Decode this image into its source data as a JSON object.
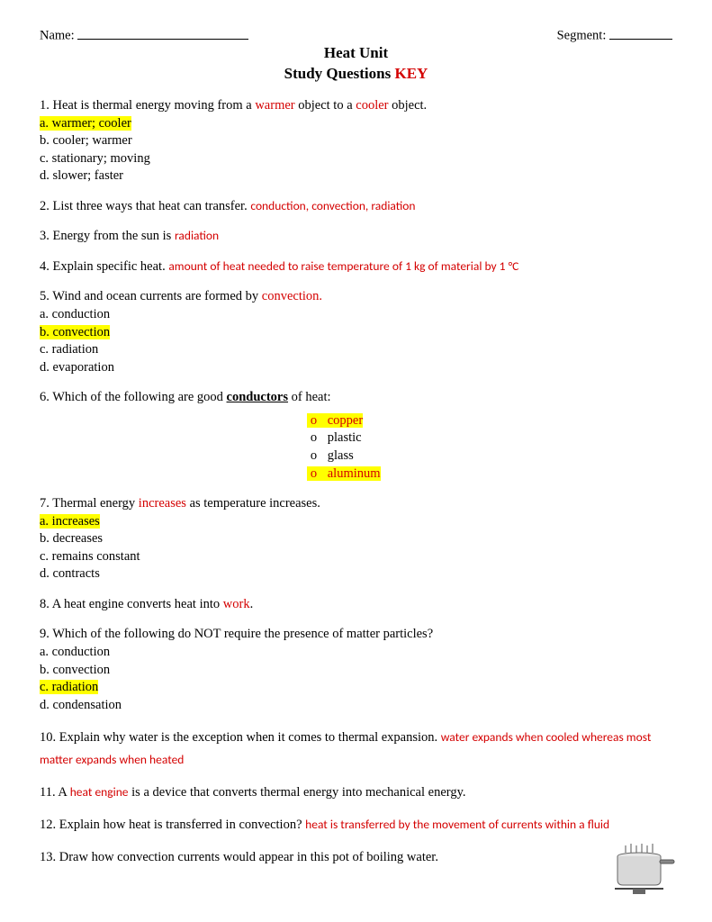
{
  "header": {
    "name_label": "Name:",
    "segment_label": "Segment:"
  },
  "title": {
    "line1": "Heat Unit",
    "line2_a": "Study Questions ",
    "line2_b": "KEY"
  },
  "q1": {
    "text_a": "1. Heat is thermal energy moving from a ",
    "blank1": "warmer",
    "text_b": " object to a ",
    "blank2": "cooler",
    "text_c": " object.",
    "a": "a. warmer; cooler",
    "b": "b. cooler; warmer",
    "c": "c. stationary; moving",
    "d": "d. slower; faster"
  },
  "q2": {
    "text": "2. List three ways that heat can transfer.  ",
    "ans": "conduction, convection, radiation"
  },
  "q3": {
    "text": "3. Energy from the sun is ",
    "ans": "radiation"
  },
  "q4": {
    "text": "4. Explain specific heat.  ",
    "ans": "amount of heat needed to raise temperature of 1 kg of material by 1 °C"
  },
  "q5": {
    "text_a": "5. Wind and ocean currents are formed by ",
    "blank": "convection",
    "text_b": ".",
    "a": "a. conduction",
    "b": "b. convection",
    "c": "c. radiation",
    "d": "d. evaporation"
  },
  "q6": {
    "text_a": "6. Which of the following are good ",
    "text_b": "conductors",
    "text_c": " of heat:",
    "o1": "copper",
    "o2": "plastic",
    "o3": "glass",
    "o4": "aluminum"
  },
  "q7": {
    "text_a": "7. Thermal energy ",
    "blank": "increases",
    "text_b": " as temperature increases.",
    "a": "a. increases",
    "b": "b. decreases",
    "c": "c. remains constant",
    "d": "d. contracts"
  },
  "q8": {
    "text_a": "8. A heat engine converts heat into ",
    "blank": "work",
    "text_b": "."
  },
  "q9": {
    "text": "9. Which of the following do NOT require the presence of matter particles?",
    "a": "a. conduction",
    "b": "b. convection",
    "c": "c. radiation",
    "d": "d. condensation"
  },
  "q10": {
    "text": "10. Explain why water is the exception when it comes to thermal expansion. ",
    "ans": "water expands when cooled whereas most matter expands when heated"
  },
  "q11": {
    "text_a": "11. A ",
    "blank": "heat engine",
    "text_b": " is a device that converts thermal energy into mechanical energy."
  },
  "q12": {
    "text": "12. Explain how heat is transferred in convection?  ",
    "ans": "heat is transferred by the movement of currents within a fluid"
  },
  "q13": {
    "text": "13. Draw how convection currents would appear in this pot of boiling water."
  }
}
